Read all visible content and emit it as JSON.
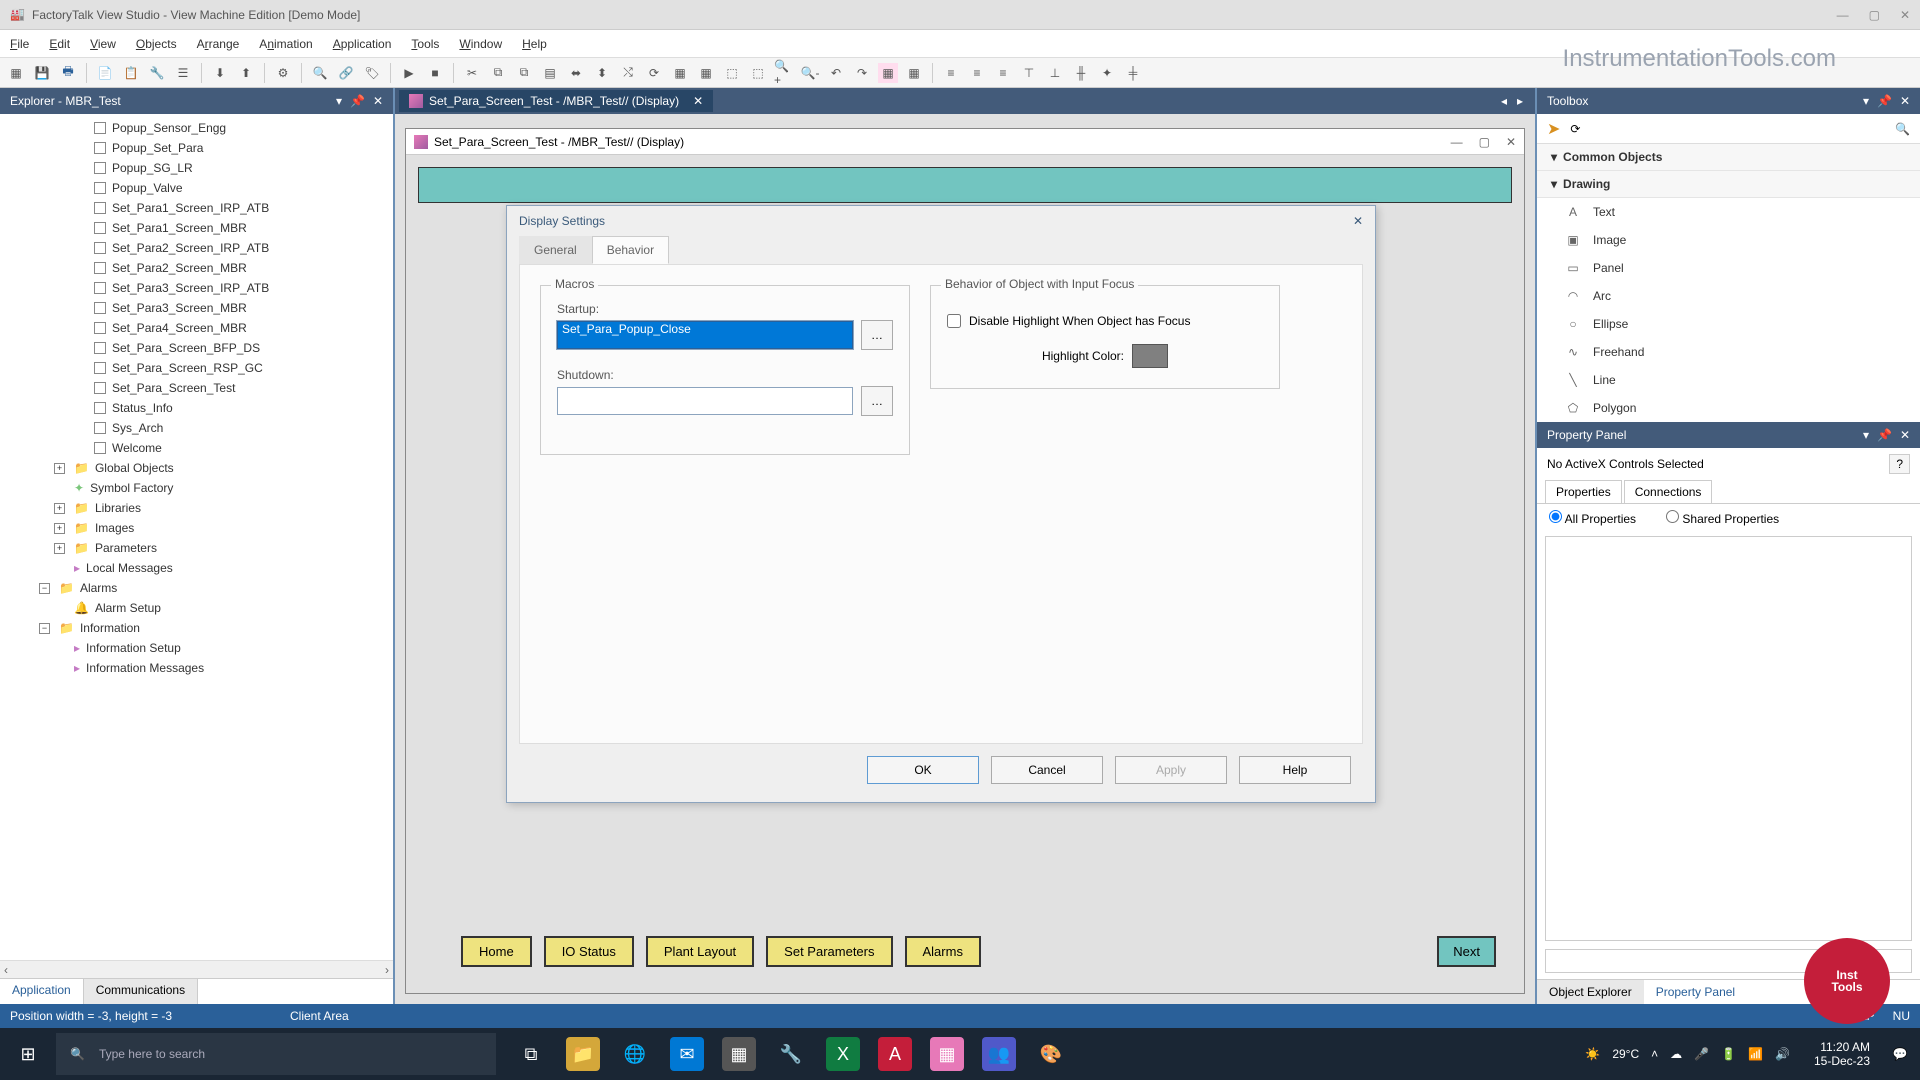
{
  "title": "FactoryTalk View Studio - View Machine Edition  [Demo Mode]",
  "watermark": "InstrumentationTools.com",
  "menu": [
    "File",
    "Edit",
    "View",
    "Objects",
    "Arrange",
    "Animation",
    "Application",
    "Tools",
    "Window",
    "Help"
  ],
  "explorer": {
    "title": "Explorer - MBR_Test",
    "items": [
      {
        "label": "Popup_Sensor_Engg",
        "level": 2
      },
      {
        "label": "Popup_Set_Para",
        "level": 2
      },
      {
        "label": "Popup_SG_LR",
        "level": 2
      },
      {
        "label": "Popup_Valve",
        "level": 2
      },
      {
        "label": "Set_Para1_Screen_IRP_ATB",
        "level": 2
      },
      {
        "label": "Set_Para1_Screen_MBR",
        "level": 2
      },
      {
        "label": "Set_Para2_Screen_IRP_ATB",
        "level": 2
      },
      {
        "label": "Set_Para2_Screen_MBR",
        "level": 2
      },
      {
        "label": "Set_Para3_Screen_IRP_ATB",
        "level": 2
      },
      {
        "label": "Set_Para3_Screen_MBR",
        "level": 2
      },
      {
        "label": "Set_Para4_Screen_MBR",
        "level": 2
      },
      {
        "label": "Set_Para_Screen_BFP_DS",
        "level": 2
      },
      {
        "label": "Set_Para_Screen_RSP_GC",
        "level": 2
      },
      {
        "label": "Set_Para_Screen_Test",
        "level": 2
      },
      {
        "label": "Status_Info",
        "level": 2
      },
      {
        "label": "Sys_Arch",
        "level": 2
      },
      {
        "label": "Welcome",
        "level": 2
      },
      {
        "label": "Global Objects",
        "level": 1,
        "exp": "+",
        "folder": true
      },
      {
        "label": "Symbol Factory",
        "level": 1,
        "icon": "sf"
      },
      {
        "label": "Libraries",
        "level": 1,
        "exp": "+",
        "folder": true
      },
      {
        "label": "Images",
        "level": 1,
        "exp": "+",
        "folder": true
      },
      {
        "label": "Parameters",
        "level": 1,
        "exp": "+",
        "folder": true
      },
      {
        "label": "Local Messages",
        "level": 1,
        "icon": "msg"
      },
      {
        "label": "Alarms",
        "level": 0,
        "exp": "−",
        "folder": true
      },
      {
        "label": "Alarm Setup",
        "level": 1,
        "icon": "alarm"
      },
      {
        "label": "Information",
        "level": 0,
        "exp": "−",
        "folder": true
      },
      {
        "label": "Information Setup",
        "level": 1,
        "icon": "info"
      },
      {
        "label": "Information Messages",
        "level": 1,
        "icon": "info"
      }
    ],
    "tabs": {
      "active": "Application",
      "other": "Communications"
    }
  },
  "doc": {
    "tab_title": "Set_Para_Screen_Test - /MBR_Test// (Display)",
    "inner_title": "Set_Para_Screen_Test - /MBR_Test// (Display)"
  },
  "dialog": {
    "title": "Display Settings",
    "tabs": [
      "General",
      "Behavior"
    ],
    "active_tab": "Behavior",
    "macros_legend": "Macros",
    "startup_label": "Startup:",
    "startup_value": "Set_Para_Popup_Close",
    "shutdown_label": "Shutdown:",
    "shutdown_value": "",
    "behavior_legend": "Behavior of Object with Input Focus",
    "disable_hl_label": "Disable Highlight When Object has Focus",
    "hl_color_label": "Highlight Color:",
    "hl_color": "#808080",
    "buttons": {
      "ok": "OK",
      "cancel": "Cancel",
      "apply": "Apply",
      "help": "Help"
    }
  },
  "nav_buttons": [
    "Home",
    "IO Status",
    "Plant Layout",
    "Set Parameters",
    "Alarms"
  ],
  "next_button": "Next",
  "toolbox": {
    "title": "Toolbox",
    "sections": [
      {
        "header": "Common Objects",
        "expand": "▾"
      },
      {
        "header": "Drawing",
        "expand": "▾",
        "items": [
          {
            "label": "Text",
            "glyph": "A"
          },
          {
            "label": "Image",
            "glyph": "▣"
          },
          {
            "label": "Panel",
            "glyph": "▭"
          },
          {
            "label": "Arc",
            "glyph": "◠"
          },
          {
            "label": "Ellipse",
            "glyph": "○"
          },
          {
            "label": "Freehand",
            "glyph": "∿"
          },
          {
            "label": "Line",
            "glyph": "╲"
          },
          {
            "label": "Polygon",
            "glyph": "⬠"
          }
        ]
      }
    ]
  },
  "property_panel": {
    "title": "Property Panel",
    "no_ctrl": "No ActiveX Controls Selected",
    "help": "?",
    "tabs": [
      "Properties",
      "Connections"
    ],
    "radios": {
      "all": "All Properties",
      "shared": "Shared Properties"
    },
    "bottom_tabs": {
      "left": "Object Explorer",
      "right": "Property Panel"
    }
  },
  "statusbar": {
    "left": "Position width = -3, height = -3",
    "mid": "Client Area",
    "right_items": [
      "CAP",
      "NU"
    ]
  },
  "taskbar": {
    "search_placeholder": "Type here to search",
    "weather": "29°C",
    "time": "11:20 AM",
    "date": "15-Dec-23"
  },
  "badge": {
    "l1": "Inst",
    "l2": "Tools"
  }
}
